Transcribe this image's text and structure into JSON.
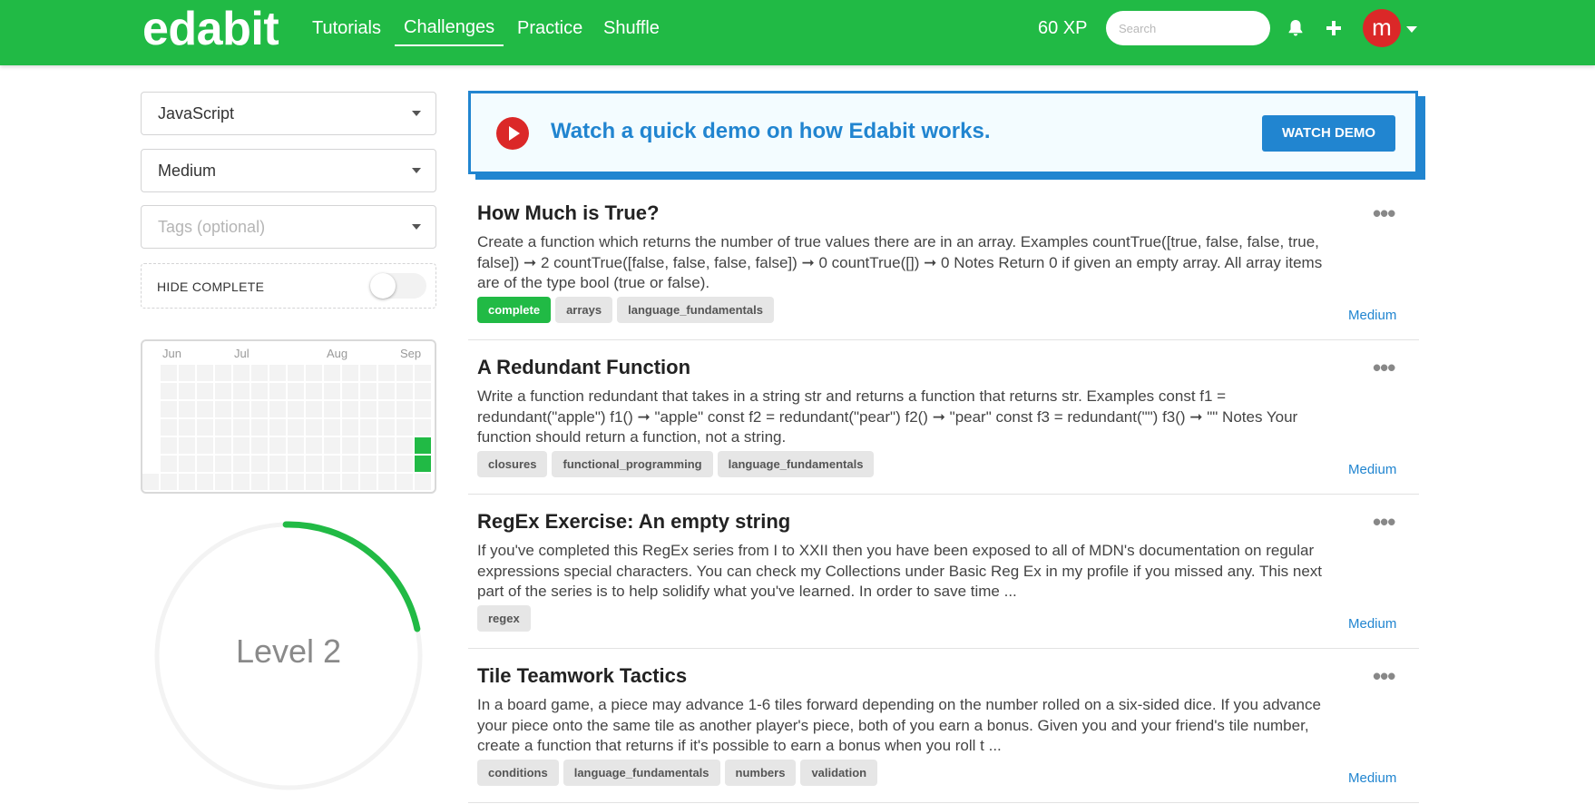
{
  "nav": {
    "logo": "edabit",
    "links": [
      "Tutorials",
      "Challenges",
      "Practice",
      "Shuffle"
    ],
    "active": "Challenges",
    "xp": "60 XP",
    "search_placeholder": "Search",
    "avatar_letter": "m"
  },
  "sidebar": {
    "language": "JavaScript",
    "difficulty": "Medium",
    "tags_placeholder": "Tags (optional)",
    "hide_complete_label": "HIDE COMPLETE",
    "hide_complete_on": false,
    "months": [
      "Jun",
      "Jul",
      "Aug",
      "Sep"
    ],
    "level_label": "Level 2",
    "level_progress": 0.22
  },
  "demo": {
    "text": "Watch a quick demo on how Edabit works.",
    "button": "WATCH DEMO"
  },
  "challenges": [
    {
      "title": "How Much is True?",
      "description": "Create a function which returns the number of true values there are in an array. Examples countTrue([true, false, false, true, false]) ➞ 2 countTrue([false, false, false, false]) ➞ 0 countTrue([]) ➞ 0 Notes Return 0 if given an empty array. All array items are of the type bool (true or false).",
      "tags": [
        "complete",
        "arrays",
        "language_fundamentals"
      ],
      "complete": true,
      "difficulty": "Medium"
    },
    {
      "title": "A Redundant Function",
      "description": "Write a function redundant that takes in a string str and returns a function that returns str. Examples const f1 = redundant(\"apple\") f1() ➞ \"apple\" const f2 = redundant(\"pear\") f2() ➞ \"pear\" const f3 = redundant(\"\") f3() ➞ \"\" Notes Your function should return a function, not a string.",
      "tags": [
        "closures",
        "functional_programming",
        "language_fundamentals"
      ],
      "complete": false,
      "difficulty": "Medium"
    },
    {
      "title": "RegEx Exercise: An empty string",
      "description": "If you've completed this RegEx series from I to XXII then you have been exposed to all of MDN's documentation on regular expressions special characters. You can check my Collections under Basic Reg Ex in my profile if you missed any. This next part of the series is to help solidify what you've learned. In order to save time ...",
      "tags": [
        "regex"
      ],
      "complete": false,
      "difficulty": "Medium"
    },
    {
      "title": "Tile Teamwork Tactics",
      "description": "In a board game, a piece may advance 1-6 tiles forward depending on the number rolled on a six-sided dice. If you advance your piece onto the same tile as another player's piece, both of you earn a bonus. Given you and your friend's tile number, create a function that returns if it's possible to earn a bonus when you roll t ...",
      "tags": [
        "conditions",
        "language_fundamentals",
        "numbers",
        "validation"
      ],
      "complete": false,
      "difficulty": "Medium"
    }
  ],
  "colors": {
    "brand_green": "#21ba45",
    "accent_blue": "#2185d0",
    "avatar_red": "#db2828"
  }
}
